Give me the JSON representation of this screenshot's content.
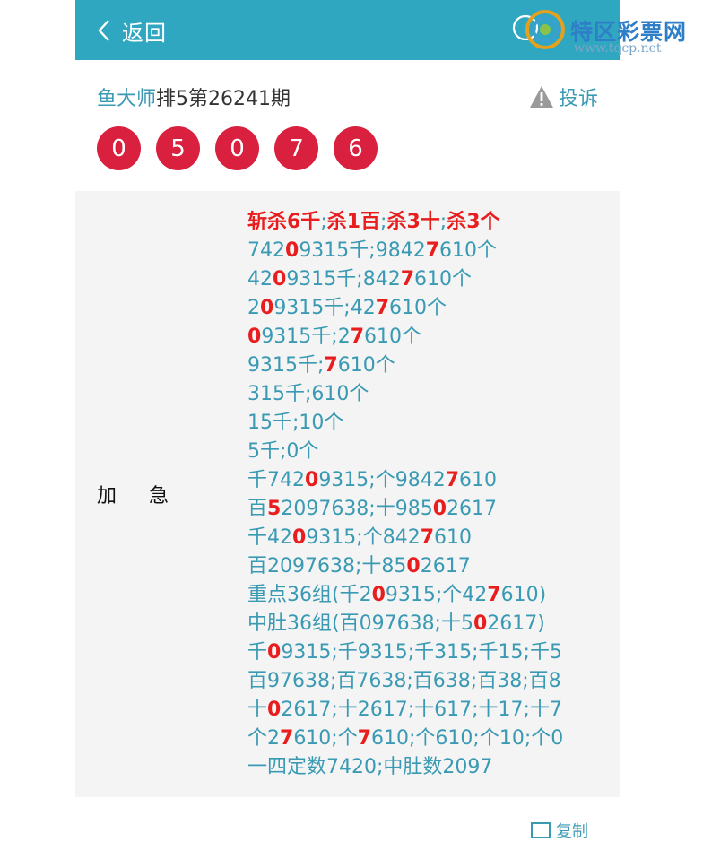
{
  "header": {
    "back_label": "返回"
  },
  "watermark": {
    "text": "特区彩票网",
    "url": "www.tqcp.net"
  },
  "post": {
    "author": "鱼大师",
    "title": "排5第26241期",
    "complain_label": "投诉"
  },
  "balls": [
    "0",
    "5",
    "0",
    "7",
    "6"
  ],
  "panel": {
    "side_label": "加急",
    "head_segments": [
      "斩杀6千",
      ";",
      "杀1百",
      ";",
      "杀3十",
      ";",
      "杀3个"
    ],
    "lines": [
      [
        {
          "t": "742"
        },
        {
          "t": "0",
          "h": true
        },
        {
          "t": "9315千;9842"
        },
        {
          "t": "7",
          "h": true
        },
        {
          "t": "610个"
        }
      ],
      [
        {
          "t": "42"
        },
        {
          "t": "0",
          "h": true
        },
        {
          "t": "9315千;842"
        },
        {
          "t": "7",
          "h": true
        },
        {
          "t": "610个"
        }
      ],
      [
        {
          "t": "2"
        },
        {
          "t": "0",
          "h": true
        },
        {
          "t": "9315千;42"
        },
        {
          "t": "7",
          "h": true
        },
        {
          "t": "610个"
        }
      ],
      [
        {
          "t": "0",
          "h": true
        },
        {
          "t": "9315千;2"
        },
        {
          "t": "7",
          "h": true
        },
        {
          "t": "610个"
        }
      ],
      [
        {
          "t": "9315千;"
        },
        {
          "t": "7",
          "h": true
        },
        {
          "t": "610个"
        }
      ],
      [
        {
          "t": "315千;610个"
        }
      ],
      [
        {
          "t": "15千;10个"
        }
      ],
      [
        {
          "t": "5千;0个"
        }
      ],
      [
        {
          "t": "千742"
        },
        {
          "t": "0",
          "h": true
        },
        {
          "t": "9315;个9842"
        },
        {
          "t": "7",
          "h": true
        },
        {
          "t": "610"
        }
      ],
      [
        {
          "t": "百"
        },
        {
          "t": "5",
          "h": true
        },
        {
          "t": "2097638;十985"
        },
        {
          "t": "0",
          "h": true
        },
        {
          "t": "2617"
        }
      ],
      [
        {
          "t": "千42"
        },
        {
          "t": "0",
          "h": true
        },
        {
          "t": "9315;个842"
        },
        {
          "t": "7",
          "h": true
        },
        {
          "t": "610"
        }
      ],
      [
        {
          "t": "百2097638;十85"
        },
        {
          "t": "0",
          "h": true
        },
        {
          "t": "2617"
        }
      ],
      [
        {
          "t": "重点36组(千2"
        },
        {
          "t": "0",
          "h": true
        },
        {
          "t": "9315;个42"
        },
        {
          "t": "7",
          "h": true
        },
        {
          "t": "610)"
        }
      ],
      [
        {
          "t": "中肚36组(百097638;十5"
        },
        {
          "t": "0",
          "h": true
        },
        {
          "t": "2617)"
        }
      ],
      [
        {
          "t": "千"
        },
        {
          "t": "0",
          "h": true
        },
        {
          "t": "9315;千9315;千315;千15;千5"
        }
      ],
      [
        {
          "t": "百97638;百7638;百638;百38;百8"
        }
      ],
      [
        {
          "t": "十"
        },
        {
          "t": "0",
          "h": true
        },
        {
          "t": "2617;十2617;十617;十17;十7"
        }
      ],
      [
        {
          "t": "个2"
        },
        {
          "t": "7",
          "h": true
        },
        {
          "t": "610;个"
        },
        {
          "t": "7",
          "h": true
        },
        {
          "t": "610;个610;个10;个0"
        }
      ],
      [
        {
          "t": "一四定数7420;中肚数2097"
        }
      ]
    ]
  },
  "footer": {
    "hint": "复制"
  },
  "colors": {
    "header_bg": "#2fa7c0",
    "ball": "#d9203f",
    "highlight": "#e81e1e",
    "link": "#3a9ab3"
  }
}
